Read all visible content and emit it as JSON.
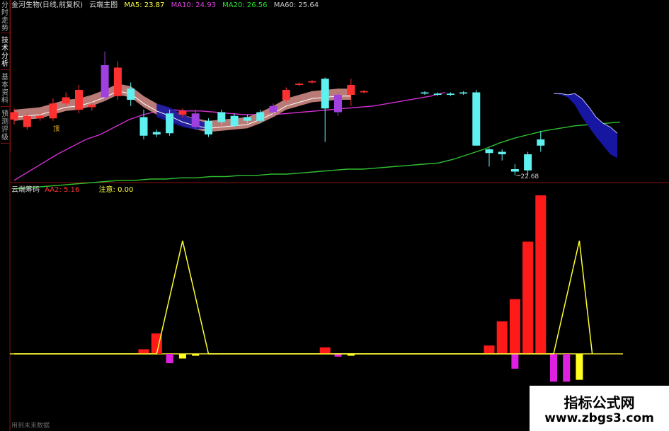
{
  "sidebar": {
    "tabs": [
      "分时走势",
      "技术分析",
      "基本资料",
      "预测评级"
    ]
  },
  "header": {
    "stock": "金河生物(日线,前复权)",
    "indicator": "云端主图",
    "ma5_label": "MA5: 23.87",
    "ma10_label": "MA10: 24.93",
    "ma20_label": "MA20: 26.56",
    "ma60_label": "MA60: 25.64"
  },
  "sub_header": {
    "name": "云端筹码",
    "aa2_label": "AA2: 5.16",
    "note_label": "注意: 0.00"
  },
  "annotations": {
    "low_price": "22.68",
    "early_mark": "顶"
  },
  "footer": {
    "text": "用到未来数据"
  },
  "watermark": {
    "title": "指标公式网",
    "url": "www.zbgs3.com"
  },
  "colors": {
    "up": "#ff3030",
    "down": "#5ff0f0",
    "ma5": "#ffffff",
    "ma10": "#d030d0",
    "ma20": "#30c030",
    "ma60": "#b0b0b0",
    "ribbon_up": "#d9908a",
    "cloud": "#1616a0",
    "signal": "#ffff30",
    "chip_bar": "#ff1a1a",
    "neg_magenta": "#e020e0",
    "neg_yellow": "#ffff20"
  },
  "chart_data": [
    {
      "type": "candlestick",
      "title": "云端主图",
      "y_range_price": [
        21.5,
        36.5
      ],
      "candles": [
        {
          "o": 27.8,
          "c": 27.2,
          "h": 28.1,
          "l": 26.8,
          "dir": "up"
        },
        {
          "o": 27.5,
          "c": 26.6,
          "h": 27.7,
          "l": 26.4,
          "dir": "down_red"
        },
        {
          "o": 27.5,
          "c": 27.3,
          "h": 27.7,
          "l": 27.1,
          "dir": "up"
        },
        {
          "o": 28.5,
          "c": 27.3,
          "h": 28.9,
          "l": 27.1,
          "dir": "up"
        },
        {
          "o": 29.0,
          "c": 28.5,
          "h": 29.4,
          "l": 28.3,
          "dir": "up"
        },
        {
          "o": 28.0,
          "c": 29.6,
          "h": 30.0,
          "l": 27.7,
          "dir": "up"
        },
        {
          "o": 28.4,
          "c": 28.2,
          "h": 28.6,
          "l": 27.9,
          "dir": "up"
        },
        {
          "o": 31.6,
          "c": 29.0,
          "h": 32.7,
          "l": 28.8,
          "dir": "purple"
        },
        {
          "o": 31.4,
          "c": 29.1,
          "h": 31.9,
          "l": 28.8,
          "dir": "up"
        },
        {
          "o": 28.8,
          "c": 29.7,
          "h": 30.2,
          "l": 28.3,
          "dir": "down"
        },
        {
          "o": 27.4,
          "c": 25.9,
          "h": 28.0,
          "l": 25.6,
          "dir": "down"
        },
        {
          "o": 26.2,
          "c": 26.0,
          "h": 26.4,
          "l": 25.8,
          "dir": "down"
        },
        {
          "o": 26.1,
          "c": 27.7,
          "h": 28.0,
          "l": 25.9,
          "dir": "down"
        },
        {
          "o": 27.6,
          "c": 27.9,
          "h": 28.1,
          "l": 27.4,
          "dir": "up"
        },
        {
          "o": 26.6,
          "c": 27.7,
          "h": 28.0,
          "l": 26.4,
          "dir": "purple"
        },
        {
          "o": 27.1,
          "c": 26.0,
          "h": 27.3,
          "l": 25.8,
          "dir": "down"
        },
        {
          "o": 27.0,
          "c": 27.8,
          "h": 28.0,
          "l": 26.8,
          "dir": "down"
        },
        {
          "o": 26.7,
          "c": 27.5,
          "h": 27.7,
          "l": 26.6,
          "dir": "down"
        },
        {
          "o": 27.1,
          "c": 27.4,
          "h": 27.6,
          "l": 26.9,
          "dir": "down"
        },
        {
          "o": 27.1,
          "c": 27.8,
          "h": 28.0,
          "l": 26.9,
          "dir": "down"
        },
        {
          "o": 28.3,
          "c": 27.8,
          "h": 28.5,
          "l": 27.6,
          "dir": "purple"
        },
        {
          "o": 29.6,
          "c": 28.8,
          "h": 29.8,
          "l": 28.6,
          "dir": "up"
        },
        {
          "o": 30.1,
          "c": 30.0,
          "h": 30.2,
          "l": 29.9,
          "dir": "up"
        },
        {
          "o": 30.3,
          "c": 30.2,
          "h": 30.4,
          "l": 30.1,
          "dir": "up"
        },
        {
          "o": 28.1,
          "c": 30.5,
          "h": 30.6,
          "l": 25.4,
          "dir": "down"
        },
        {
          "o": 29.2,
          "c": 27.8,
          "h": 29.4,
          "l": 27.5,
          "dir": "purple"
        },
        {
          "o": 30.0,
          "c": 29.2,
          "h": 30.5,
          "l": 28.3,
          "dir": "up"
        },
        {
          "o": 29.5,
          "c": 29.4,
          "h": 29.6,
          "l": 29.3,
          "dir": "up"
        },
        {
          "o": null
        },
        {
          "o": null
        },
        {
          "o": null
        },
        {
          "o": 29.4,
          "c": 29.3,
          "h": 29.5,
          "l": 29.2,
          "dir": "down"
        },
        {
          "o": 29.3,
          "c": 29.2,
          "h": 29.4,
          "l": 29.1,
          "dir": "down"
        },
        {
          "o": 29.3,
          "c": 29.2,
          "h": 29.4,
          "l": 29.1,
          "dir": "down"
        },
        {
          "o": 29.4,
          "c": 29.3,
          "h": 29.5,
          "l": 29.2,
          "dir": "down"
        },
        {
          "o": 29.4,
          "c": 25.1,
          "h": 29.6,
          "l": 25.1,
          "dir": "down"
        },
        {
          "o": 24.8,
          "c": 24.5,
          "h": 24.9,
          "l": 23.4,
          "dir": "down"
        },
        {
          "o": 24.6,
          "c": 24.4,
          "h": 24.8,
          "l": 23.9,
          "dir": "down"
        },
        {
          "o": 23.2,
          "c": 23.0,
          "h": 23.6,
          "l": 22.7,
          "dir": "down"
        },
        {
          "o": 23.1,
          "c": 24.4,
          "h": 24.6,
          "l": 22.7,
          "dir": "down"
        },
        {
          "o": 25.1,
          "c": 25.6,
          "h": 26.3,
          "l": 24.6,
          "dir": "down"
        }
      ],
      "ma10": [
        22.3,
        23.0,
        23.7,
        24.4,
        25.0,
        25.6,
        26.0,
        26.6,
        27.2,
        27.6,
        27.9,
        28.0,
        27.9,
        27.9,
        27.8,
        27.7,
        27.6,
        27.6,
        27.6,
        27.7,
        27.8,
        27.9,
        28.0,
        28.1,
        28.2,
        28.3,
        28.5,
        28.7,
        28.9,
        29.1,
        29.4
      ],
      "ma20": [
        21.6,
        21.7,
        21.8,
        21.9,
        22.0,
        22.1,
        22.2,
        22.3,
        22.3,
        22.4,
        22.4,
        22.5,
        22.5,
        22.6,
        22.6,
        22.7,
        22.7,
        22.8,
        22.8,
        22.9,
        23.0,
        23.1,
        23.2,
        23.2,
        23.3,
        23.4,
        23.5,
        23.6,
        23.7,
        24.0,
        24.4,
        24.8,
        25.3,
        25.7,
        26.0,
        26.3,
        26.5,
        26.7,
        26.8,
        26.9,
        27.0
      ],
      "ma5": [
        27.4,
        27.5,
        27.6,
        27.9,
        28.2,
        28.3,
        28.6,
        29.0,
        29.5,
        29.3,
        28.5,
        27.9,
        27.5,
        27.0,
        26.7,
        26.5,
        26.6,
        26.7,
        26.8,
        27.2,
        27.7,
        28.3,
        28.6,
        28.9,
        29.0,
        29.1,
        29.1
      ],
      "cloud_upper": [
        29.3,
        29.3,
        29.2,
        29.3,
        28.9,
        28.2,
        27.4,
        26.9,
        26.6,
        26.1
      ],
      "cloud_lower": [
        29.3,
        29.2,
        29.0,
        28.4,
        27.4,
        26.6,
        25.8,
        25.1,
        24.4,
        24.1
      ],
      "low_marker_index": 38
    },
    {
      "type": "bar",
      "title": "云端筹码",
      "y_range": [
        -3,
        18
      ],
      "positive_bars": [
        {
          "i": 10,
          "v": 0.5
        },
        {
          "i": 11,
          "v": 2.2
        },
        {
          "i": 24,
          "v": 0.7
        },
        {
          "i": 36,
          "v": 0.9
        },
        {
          "i": 37,
          "v": 3.5
        },
        {
          "i": 38,
          "v": 5.9
        },
        {
          "i": 39,
          "v": 12.1
        },
        {
          "i": 40,
          "v": 17.1
        }
      ],
      "negative_bars": [
        {
          "i": 12,
          "v": -1.0,
          "c": "neg_magenta"
        },
        {
          "i": 13,
          "v": -0.5,
          "c": "neg_yellow"
        },
        {
          "i": 14,
          "v": -0.2,
          "c": "neg_yellow"
        },
        {
          "i": 25,
          "v": -0.3,
          "c": "neg_magenta"
        },
        {
          "i": 26,
          "v": -0.2,
          "c": "neg_yellow"
        },
        {
          "i": 38,
          "v": -1.6,
          "c": "neg_magenta"
        },
        {
          "i": 41,
          "v": -3.0,
          "c": "neg_magenta"
        },
        {
          "i": 42,
          "v": -3.0,
          "c": "neg_magenta"
        },
        {
          "i": 43,
          "v": -2.8,
          "c": "neg_yellow"
        }
      ],
      "signal_line": [
        {
          "i": 0,
          "v": 0
        },
        {
          "i": 11,
          "v": 0
        },
        {
          "i": 13,
          "v": 12.2
        },
        {
          "i": 15,
          "v": 0
        },
        {
          "i": 41,
          "v": 0
        },
        {
          "i": 43,
          "v": 12.2
        },
        {
          "i": 44,
          "v": 0
        }
      ]
    }
  ]
}
